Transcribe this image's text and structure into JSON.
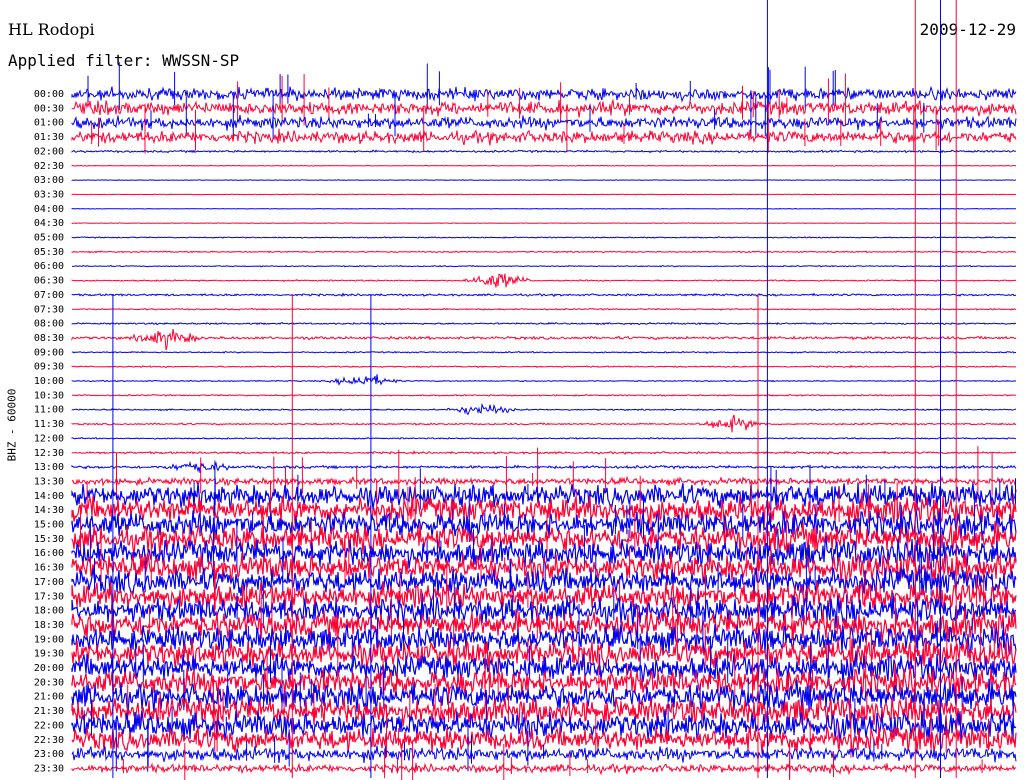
{
  "header": {
    "station": "HL Rodopi",
    "date": "2009-12-29",
    "filter": "Applied filter: WWSSN-SP"
  },
  "chart_data": {
    "type": "line",
    "title": "HL Rodopi",
    "ylabel": "BHZ - 60000",
    "colors": {
      "even_rows": "#0000ee",
      "odd_rows": "#ff0033"
    },
    "rows": [
      {
        "label": "00:00",
        "amp": 0.9
      },
      {
        "label": "00:30",
        "amp": 1.0
      },
      {
        "label": "01:00",
        "amp": 0.9
      },
      {
        "label": "01:30",
        "amp": 0.9
      },
      {
        "label": "02:00",
        "amp": 0.15
      },
      {
        "label": "02:30",
        "amp": 0.05
      },
      {
        "label": "03:00",
        "amp": 0.04
      },
      {
        "label": "03:30",
        "amp": 0.05
      },
      {
        "label": "04:00",
        "amp": 0.04
      },
      {
        "label": "04:30",
        "amp": 0.04
      },
      {
        "label": "05:00",
        "amp": 0.08
      },
      {
        "label": "05:30",
        "amp": 0.1
      },
      {
        "label": "06:00",
        "amp": 0.08
      },
      {
        "label": "06:30",
        "amp": 0.1
      },
      {
        "label": "07:00",
        "amp": 0.15
      },
      {
        "label": "07:30",
        "amp": 0.1
      },
      {
        "label": "08:00",
        "amp": 0.12
      },
      {
        "label": "08:30",
        "amp": 0.2
      },
      {
        "label": "09:00",
        "amp": 0.1
      },
      {
        "label": "09:30",
        "amp": 0.1
      },
      {
        "label": "10:00",
        "amp": 0.08
      },
      {
        "label": "10:30",
        "amp": 0.1
      },
      {
        "label": "11:00",
        "amp": 0.1
      },
      {
        "label": "11:30",
        "amp": 0.12
      },
      {
        "label": "12:00",
        "amp": 0.1
      },
      {
        "label": "12:30",
        "amp": 0.15
      },
      {
        "label": "13:00",
        "amp": 0.2
      },
      {
        "label": "13:30",
        "amp": 0.5
      },
      {
        "label": "14:00",
        "amp": 1.6
      },
      {
        "label": "14:30",
        "amp": 1.8
      },
      {
        "label": "15:00",
        "amp": 1.8
      },
      {
        "label": "15:30",
        "amp": 1.8
      },
      {
        "label": "16:00",
        "amp": 1.8
      },
      {
        "label": "16:30",
        "amp": 1.8
      },
      {
        "label": "17:00",
        "amp": 1.8
      },
      {
        "label": "17:30",
        "amp": 1.8
      },
      {
        "label": "18:00",
        "amp": 1.8
      },
      {
        "label": "18:30",
        "amp": 1.8
      },
      {
        "label": "19:00",
        "amp": 1.8
      },
      {
        "label": "19:30",
        "amp": 1.8
      },
      {
        "label": "20:00",
        "amp": 1.8
      },
      {
        "label": "20:30",
        "amp": 1.8
      },
      {
        "label": "21:00",
        "amp": 1.8
      },
      {
        "label": "21:30",
        "amp": 1.8
      },
      {
        "label": "22:00",
        "amp": 1.8
      },
      {
        "label": "22:30",
        "amp": 1.6
      },
      {
        "label": "23:00",
        "amp": 1.0
      },
      {
        "label": "23:30",
        "amp": 0.6
      }
    ],
    "events": [
      {
        "row": "06:30",
        "minute": 13.5,
        "amp": 1.0
      },
      {
        "row": "08:30",
        "minute": 3.0,
        "amp": 1.0
      },
      {
        "row": "10:00",
        "minute": 9.3,
        "amp": 0.8
      },
      {
        "row": "11:00",
        "minute": 13.0,
        "amp": 0.7
      },
      {
        "row": "11:30",
        "minute": 21.0,
        "amp": 0.8
      },
      {
        "row": "13:00",
        "minute": 4.0,
        "amp": 0.6
      }
    ],
    "spikes_minutes": [
      1.3,
      7.0,
      9.5,
      21.8,
      22.1,
      26.8,
      27.6,
      28.1
    ]
  }
}
